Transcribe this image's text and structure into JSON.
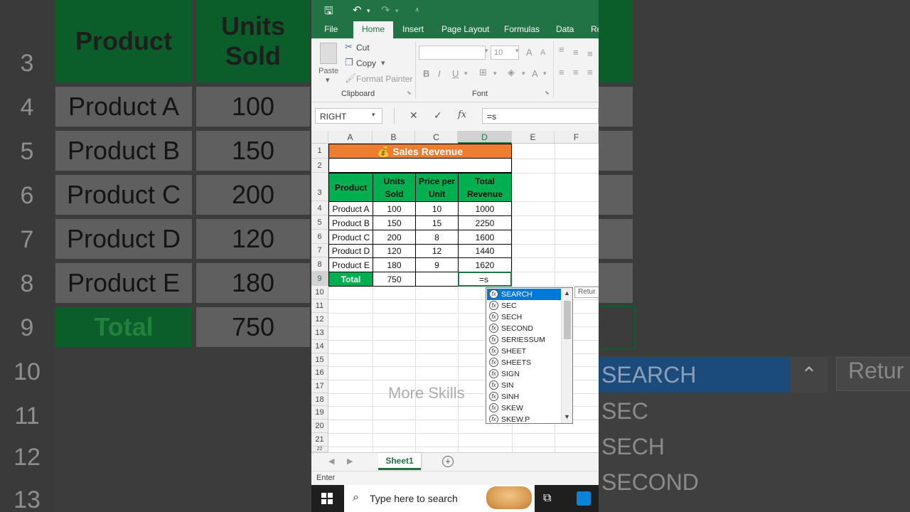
{
  "app": {
    "title_icons": [
      "save-icon",
      "undo-icon",
      "redo-icon",
      "customize-icon"
    ]
  },
  "tabs": [
    "File",
    "Home",
    "Insert",
    "Page Layout",
    "Formulas",
    "Data",
    "Re"
  ],
  "ribbon": {
    "paste": "Paste",
    "cut": "Cut",
    "copy": "Copy",
    "format_painter": "Format Painter",
    "clipboard": "Clipboard",
    "font_size": "10",
    "bold": "B",
    "italic": "I",
    "underline": "U",
    "font": "Font",
    "grow": "A",
    "shrink": "A"
  },
  "formula_bar": {
    "name_box": "RIGHT",
    "cancel": "✕",
    "enter": "✓",
    "fx": "fx",
    "formula": "=s"
  },
  "columns": [
    "A",
    "B",
    "C",
    "D",
    "E",
    "F"
  ],
  "rows": [
    "1",
    "2",
    "3",
    "4",
    "5",
    "6",
    "7",
    "8",
    "9",
    "10",
    "11",
    "12",
    "13",
    "14",
    "15",
    "16",
    "17",
    "18",
    "19",
    "20",
    "21",
    "22"
  ],
  "sheet": {
    "title": "💰 Sales Revenue",
    "headers": [
      "Product",
      "Units Sold",
      "Price per Unit",
      "Total Revenue"
    ],
    "data": [
      [
        "Product A",
        "100",
        "10",
        "1000"
      ],
      [
        "Product B",
        "150",
        "15",
        "2250"
      ],
      [
        "Product C",
        "200",
        "8",
        "1600"
      ],
      [
        "Product D",
        "120",
        "12",
        "1440"
      ],
      [
        "Product E",
        "180",
        "9",
        "1620"
      ]
    ],
    "total_label": "Total",
    "total_units": "750",
    "active_value": "=s"
  },
  "autocomplete": [
    "SEARCH",
    "SEC",
    "SECH",
    "SECOND",
    "SERIESSUM",
    "SHEET",
    "SHEETS",
    "SIGN",
    "SIN",
    "SINH",
    "SKEW",
    "SKEW.P"
  ],
  "tooltip": "Retur",
  "watermark": "More Skills",
  "sheet_tab": "Sheet1",
  "status": "Enter",
  "taskbar": {
    "search_placeholder": "Type here to search"
  },
  "background": {
    "rownums": [
      "3",
      "4",
      "5",
      "6",
      "7",
      "8",
      "9",
      "10",
      "11",
      "12",
      "13"
    ],
    "header_product": "Product",
    "header_units_1": "Units",
    "header_units_2": "Sold",
    "products": [
      "Product A",
      "Product B",
      "Product C",
      "Product D",
      "Product E"
    ],
    "units": [
      "100",
      "150",
      "200",
      "120",
      "180"
    ],
    "total": "Total",
    "total_units": "750",
    "list": [
      "SEARCH",
      "SEC",
      "SECH",
      "SECOND"
    ],
    "retur": "Retur"
  },
  "colors": {
    "excel_green": "#217346",
    "header_green": "#00b050",
    "title_orange": "#ed7d31",
    "select_blue": "#0078d7"
  }
}
